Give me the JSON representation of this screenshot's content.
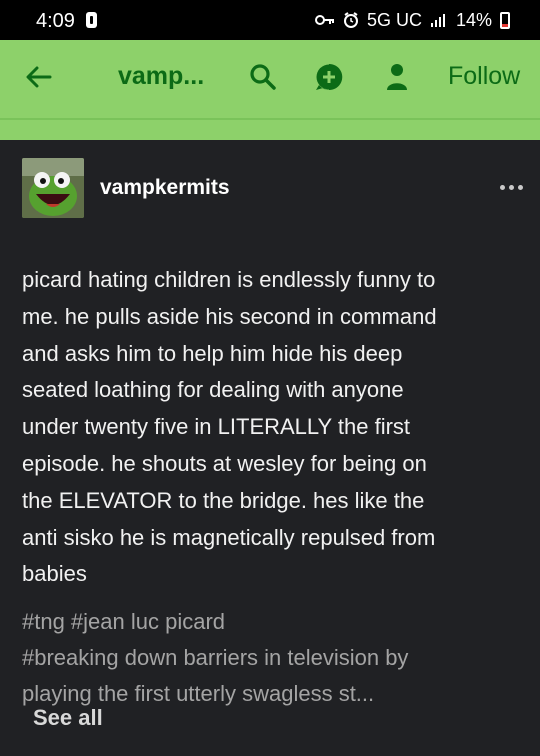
{
  "status_bar": {
    "time": "4:09",
    "network": "5G UC",
    "battery": "14%",
    "icons": [
      "notification-icon",
      "key-icon",
      "alarm-icon",
      "signal-icon",
      "battery-icon"
    ]
  },
  "header": {
    "blog_name": "vamp...",
    "follow_label": "Follow",
    "color": "#8dd16a",
    "text_color": "#0c6b16",
    "icons": [
      "back-arrow-icon",
      "search-icon",
      "compose-icon",
      "profile-icon"
    ]
  },
  "post": {
    "author": "vampkermits",
    "avatar_icon": "kermit-avatar",
    "more_icon": "more-options-icon",
    "body_lines": [
      "picard hating children is endlessly funny to",
      "me. he pulls aside his second in command",
      "and asks him to help him hide his deep",
      "seated loathing for dealing with anyone",
      "under twenty five in LITERALLY the first",
      "episode. he shouts at wesley for being on",
      "the ELEVATOR to the bridge. hes like the",
      "anti sisko he is magnetically repulsed from",
      "babies"
    ],
    "tag_lines": [
      "#tng  #jean luc picard",
      "#breaking down barriers in television by",
      "playing the first utterly swagless st..."
    ],
    "see_all": "See all",
    "background": "#202124"
  }
}
